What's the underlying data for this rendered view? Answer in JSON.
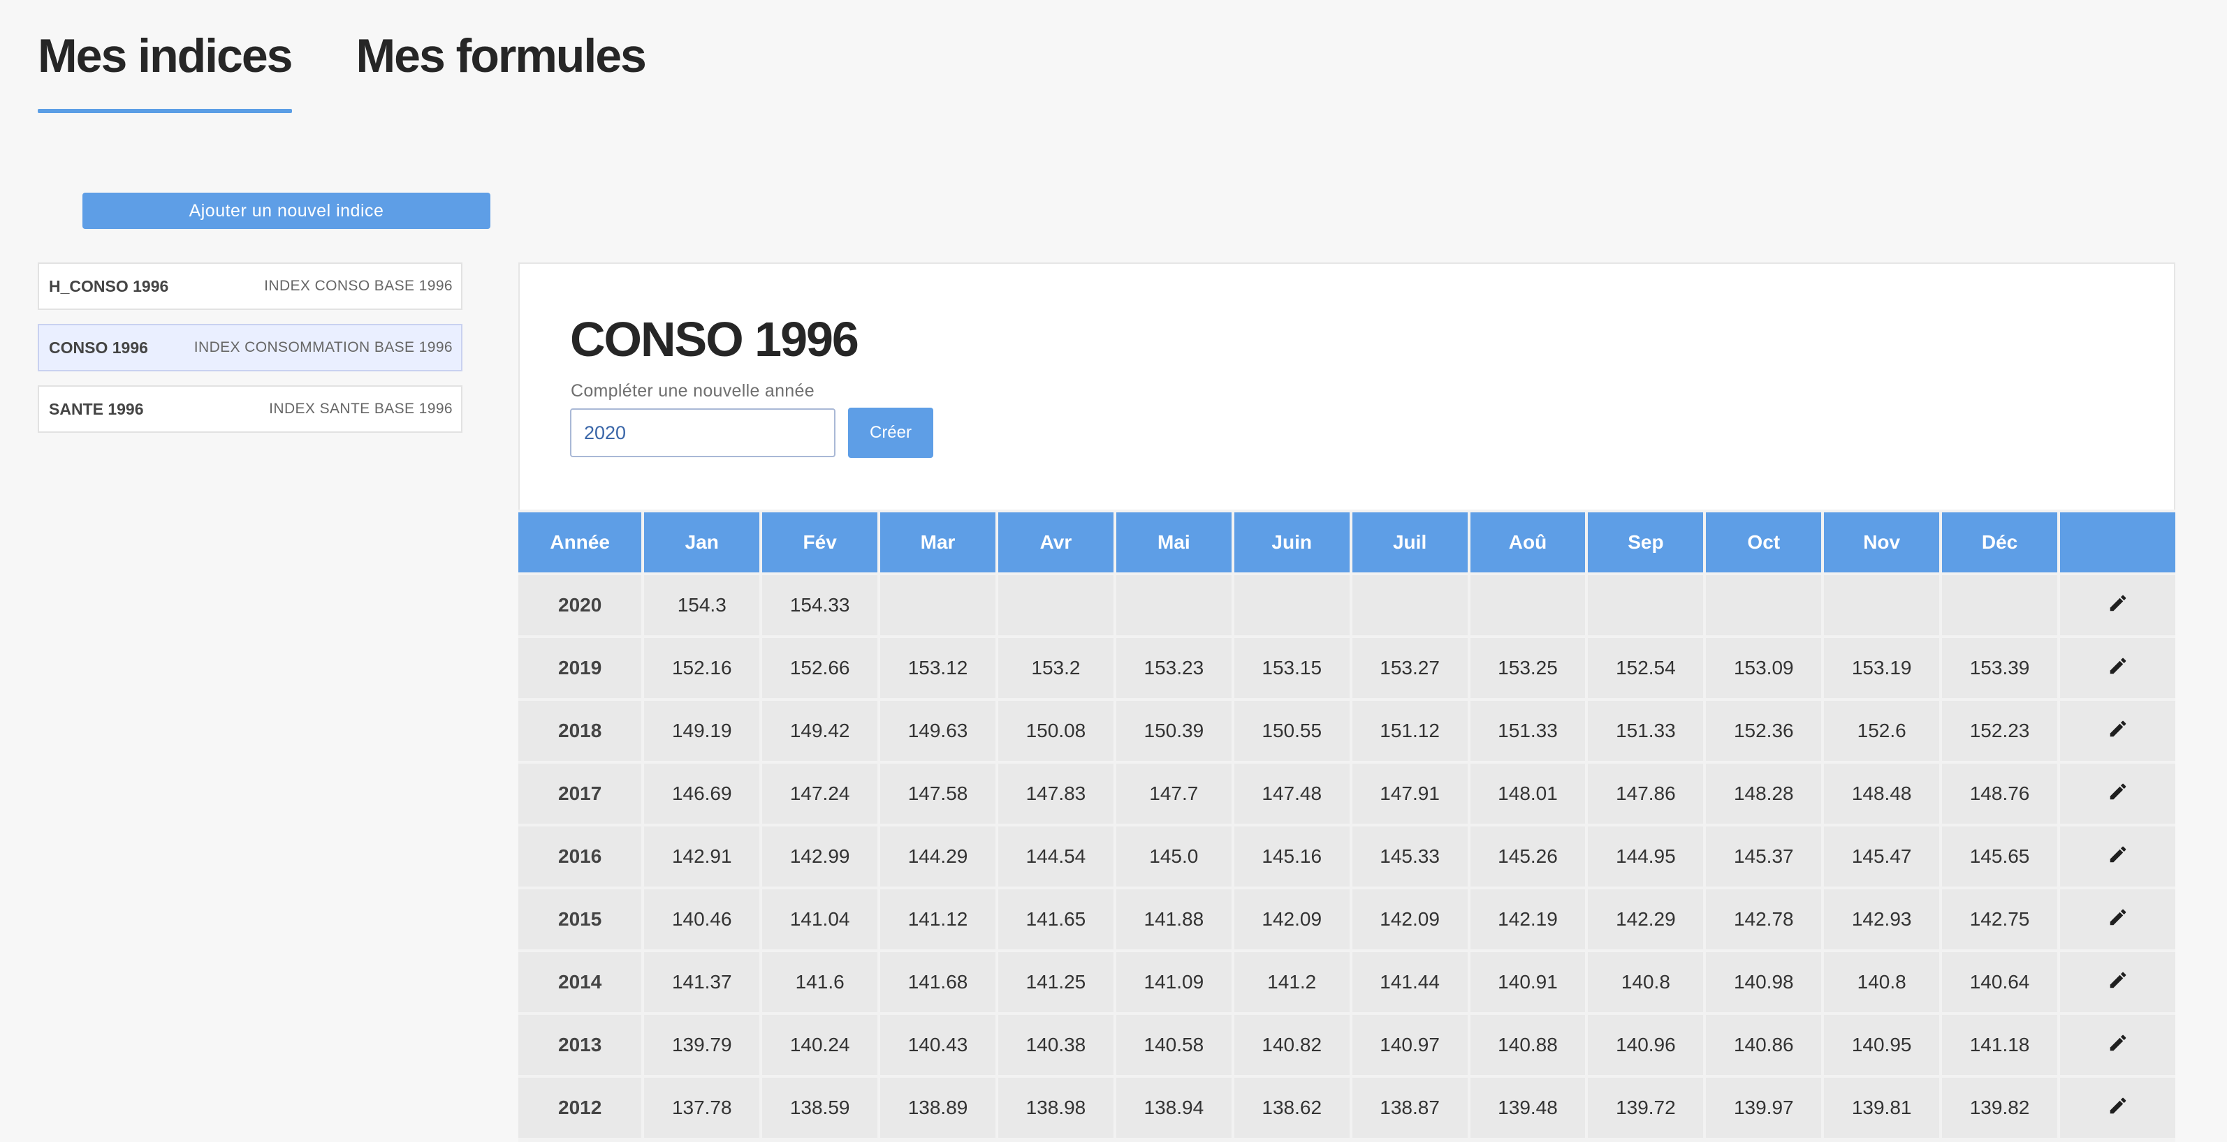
{
  "tabs": [
    {
      "label": "Mes indices",
      "active": true
    },
    {
      "label": "Mes formules",
      "active": false
    }
  ],
  "add_button_label": "Ajouter un nouvel indice",
  "indices": [
    {
      "code": "H_CONSO 1996",
      "description": "INDEX CONSO BASE 1996",
      "selected": false
    },
    {
      "code": "CONSO 1996",
      "description": "INDEX CONSOMMATION BASE 1996",
      "selected": true
    },
    {
      "code": "SANTE 1996",
      "description": "INDEX SANTE BASE 1996",
      "selected": false
    }
  ],
  "detail": {
    "title": "CONSO 1996",
    "new_year_label": "Compléter une nouvelle année",
    "new_year_value": "2020",
    "create_label": "Créer"
  },
  "table": {
    "headers": [
      "Année",
      "Jan",
      "Fév",
      "Mar",
      "Avr",
      "Mai",
      "Juin",
      "Juil",
      "Aoû",
      "Sep",
      "Oct",
      "Nov",
      "Déc",
      ""
    ],
    "rows": [
      {
        "year": "2020",
        "values": [
          "154.3",
          "154.33",
          "",
          "",
          "",
          "",
          "",
          "",
          "",
          "",
          "",
          ""
        ]
      },
      {
        "year": "2019",
        "values": [
          "152.16",
          "152.66",
          "153.12",
          "153.2",
          "153.23",
          "153.15",
          "153.27",
          "153.25",
          "152.54",
          "153.09",
          "153.19",
          "153.39"
        ]
      },
      {
        "year": "2018",
        "values": [
          "149.19",
          "149.42",
          "149.63",
          "150.08",
          "150.39",
          "150.55",
          "151.12",
          "151.33",
          "151.33",
          "152.36",
          "152.6",
          "152.23"
        ]
      },
      {
        "year": "2017",
        "values": [
          "146.69",
          "147.24",
          "147.58",
          "147.83",
          "147.7",
          "147.48",
          "147.91",
          "148.01",
          "147.86",
          "148.28",
          "148.48",
          "148.76"
        ]
      },
      {
        "year": "2016",
        "values": [
          "142.91",
          "142.99",
          "144.29",
          "144.54",
          "145.0",
          "145.16",
          "145.33",
          "145.26",
          "144.95",
          "145.37",
          "145.47",
          "145.65"
        ]
      },
      {
        "year": "2015",
        "values": [
          "140.46",
          "141.04",
          "141.12",
          "141.65",
          "141.88",
          "142.09",
          "142.09",
          "142.19",
          "142.29",
          "142.78",
          "142.93",
          "142.75"
        ]
      },
      {
        "year": "2014",
        "values": [
          "141.37",
          "141.6",
          "141.68",
          "141.25",
          "141.09",
          "141.2",
          "141.44",
          "140.91",
          "140.8",
          "140.98",
          "140.8",
          "140.64"
        ]
      },
      {
        "year": "2013",
        "values": [
          "139.79",
          "140.24",
          "140.43",
          "140.38",
          "140.58",
          "140.82",
          "140.97",
          "140.88",
          "140.96",
          "140.86",
          "140.95",
          "141.18"
        ]
      },
      {
        "year": "2012",
        "values": [
          "137.78",
          "138.59",
          "138.89",
          "138.98",
          "138.94",
          "138.62",
          "138.87",
          "139.48",
          "139.72",
          "139.97",
          "139.81",
          "139.82"
        ]
      }
    ],
    "row_action_icon": "pencil-icon"
  },
  "colors": {
    "accent": "#5e9ee6",
    "selected_bg": "#eaefff",
    "cell_bg": "#e9e9e9",
    "page_bg": "#f7f7f7"
  }
}
